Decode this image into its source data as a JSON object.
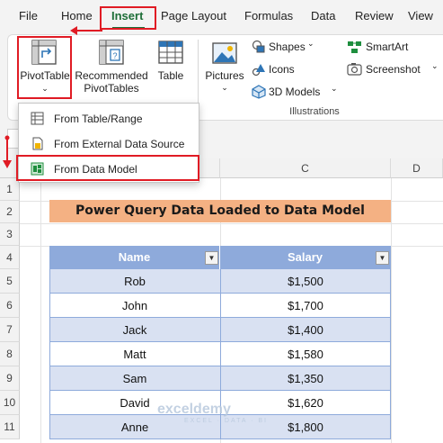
{
  "menu": {
    "tabs": [
      "File",
      "Home",
      "Insert",
      "Page Layout",
      "Formulas",
      "Data",
      "Review",
      "View"
    ],
    "active_tab": "Insert"
  },
  "ribbon": {
    "pivottable_label": "PivotTable",
    "recommended_line1": "Recommended",
    "recommended_line2": "PivotTables",
    "table_label": "Table",
    "pictures_label": "Pictures",
    "shapes_label": "Shapes",
    "icons_label": "Icons",
    "models_label": "3D Models",
    "smartart_label": "SmartArt",
    "screenshot_label": "Screenshot",
    "group_label": "Illustrations"
  },
  "dropdown": {
    "items": [
      {
        "label": "From Table/Range",
        "icon": "table-range-icon"
      },
      {
        "label": "From External Data Source",
        "icon": "external-data-icon"
      },
      {
        "label": "From Data Model",
        "icon": "data-model-icon"
      }
    ]
  },
  "grid": {
    "columns": [
      "C",
      "D"
    ],
    "rows": [
      "1",
      "2",
      "3",
      "4",
      "5",
      "6",
      "7",
      "8",
      "9",
      "10",
      "11"
    ]
  },
  "sheet": {
    "title": "Power Query Data Loaded to Data Model",
    "headers": [
      "Name",
      "Salary"
    ],
    "rows": [
      [
        "Rob",
        "$1,500"
      ],
      [
        "John",
        "$1,700"
      ],
      [
        "Jack",
        "$1,400"
      ],
      [
        "Matt",
        "$1,580"
      ],
      [
        "Sam",
        "$1,350"
      ],
      [
        "David",
        "$1,620"
      ],
      [
        "Anne",
        "$1,800"
      ]
    ]
  },
  "watermark": {
    "name": "exceldemy",
    "tagline": "EXCEL · DATA · BI"
  },
  "colors": {
    "accent_green": "#1e6e38",
    "highlight_red": "#e01b24",
    "title_fill": "#f4b183",
    "header_fill": "#8eaadb"
  }
}
